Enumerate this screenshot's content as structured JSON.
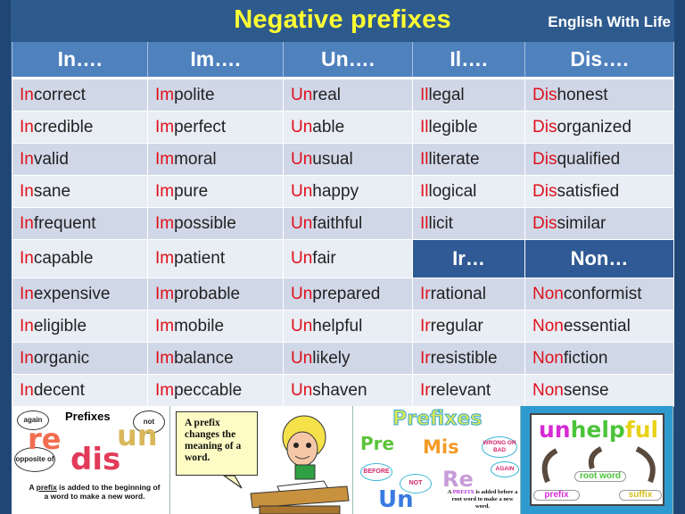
{
  "title": "Negative prefixes",
  "brand": "English With Life",
  "colors": {
    "title": "#ffff33",
    "header_bg": "#4f81bd",
    "subheader_bg": "#2f5a95",
    "prefix_highlight": "#e0101a",
    "row_odd": "#d0d8e8",
    "row_even": "#e9edf4"
  },
  "headers": [
    "In….",
    "Im….",
    "Un….",
    "Il….",
    "Dis…."
  ],
  "subheaders": [
    "Ir…",
    "Non…"
  ],
  "rows": [
    [
      [
        "In",
        "correct"
      ],
      [
        "Im",
        "polite"
      ],
      [
        "Un",
        "real"
      ],
      [
        "Il",
        "legal"
      ],
      [
        "Dis",
        "honest"
      ]
    ],
    [
      [
        "In",
        "credible"
      ],
      [
        "Im",
        "perfect"
      ],
      [
        "Un",
        "able"
      ],
      [
        "Il",
        "legible"
      ],
      [
        "Dis",
        "organized"
      ]
    ],
    [
      [
        "In",
        "valid"
      ],
      [
        "Im",
        "moral"
      ],
      [
        "Un",
        "usual"
      ],
      [
        "Il",
        "literate"
      ],
      [
        "Dis",
        "qualified"
      ]
    ],
    [
      [
        "In",
        "sane"
      ],
      [
        "Im",
        "pure"
      ],
      [
        "Un",
        "happy"
      ],
      [
        "Il",
        "logical"
      ],
      [
        "Dis",
        "satisfied"
      ]
    ],
    [
      [
        "In",
        "frequent"
      ],
      [
        "Im",
        "possible"
      ],
      [
        "Un",
        "faithful"
      ],
      [
        "Il",
        "licit"
      ],
      [
        "Dis",
        "similar"
      ]
    ],
    [
      [
        "In",
        "capable"
      ],
      [
        "Im",
        "patient"
      ],
      [
        "Un",
        "fair"
      ]
    ],
    [
      [
        "In",
        "expensive"
      ],
      [
        "Im",
        "probable"
      ],
      [
        "Un",
        "prepared"
      ],
      [
        "Ir",
        "rational"
      ],
      [
        "Non",
        "conformist"
      ]
    ],
    [
      [
        "In",
        "eligible"
      ],
      [
        "Im",
        "mobile"
      ],
      [
        "Un",
        "helpful"
      ],
      [
        "Ir",
        "regular"
      ],
      [
        "Non",
        "essential"
      ]
    ],
    [
      [
        "In",
        "organic"
      ],
      [
        "Im",
        "balance"
      ],
      [
        "Un",
        "likely"
      ],
      [
        "Ir",
        "resistible"
      ],
      [
        "Non",
        "fiction"
      ]
    ],
    [
      [
        "In",
        "decent"
      ],
      [
        "Im",
        "peccable"
      ],
      [
        "Un",
        "shaven"
      ],
      [
        "Ir",
        "relevant"
      ],
      [
        "Non",
        "sense"
      ]
    ]
  ],
  "panels": {
    "p1": {
      "heading": "Prefixes",
      "bubbles": [
        "again",
        "not",
        "opposite of"
      ],
      "words": [
        "re",
        "un",
        "dis"
      ],
      "caption_a": "A ",
      "caption_b": "prefix",
      "caption_c": " is added to the beginning of a word to make a new word."
    },
    "p2": {
      "note": "A prefix changes the meaning of a word."
    },
    "p3": {
      "heading": "Prefixes",
      "words": [
        "Pre",
        "Mis",
        "Re",
        "Un"
      ],
      "bubbles": [
        "BEFORE",
        "WRONG OR BAD",
        "AGAIN",
        "NOT"
      ],
      "caption_a": "A ",
      "caption_b": "PREFIX",
      "caption_c": " is added before a root word to make a new word."
    },
    "p4": {
      "word_prefix": "un",
      "word_root": "help",
      "word_suffix": "ful",
      "labels": [
        "prefix",
        "root word",
        "suffix"
      ]
    }
  }
}
